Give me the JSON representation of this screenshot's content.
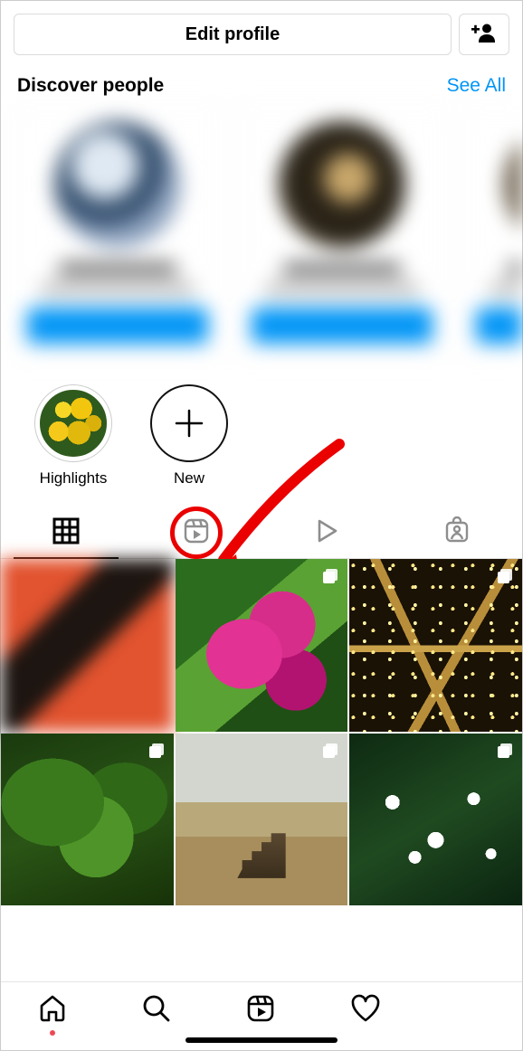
{
  "header": {
    "edit_profile_label": "Edit profile"
  },
  "discover": {
    "title": "Discover people",
    "see_all_label": "See All"
  },
  "highlights": {
    "items": [
      {
        "label": "Highlights"
      },
      {
        "label": "New"
      }
    ]
  },
  "tabs": {
    "grid": "grid-icon",
    "reels": "reels-icon",
    "video": "play-icon",
    "tagged": "tagged-icon",
    "active": "grid",
    "annotated": "reels"
  },
  "bottom_nav": {
    "home": "home-icon",
    "search": "search-icon",
    "reels": "reels-icon",
    "activity": "heart-icon"
  }
}
